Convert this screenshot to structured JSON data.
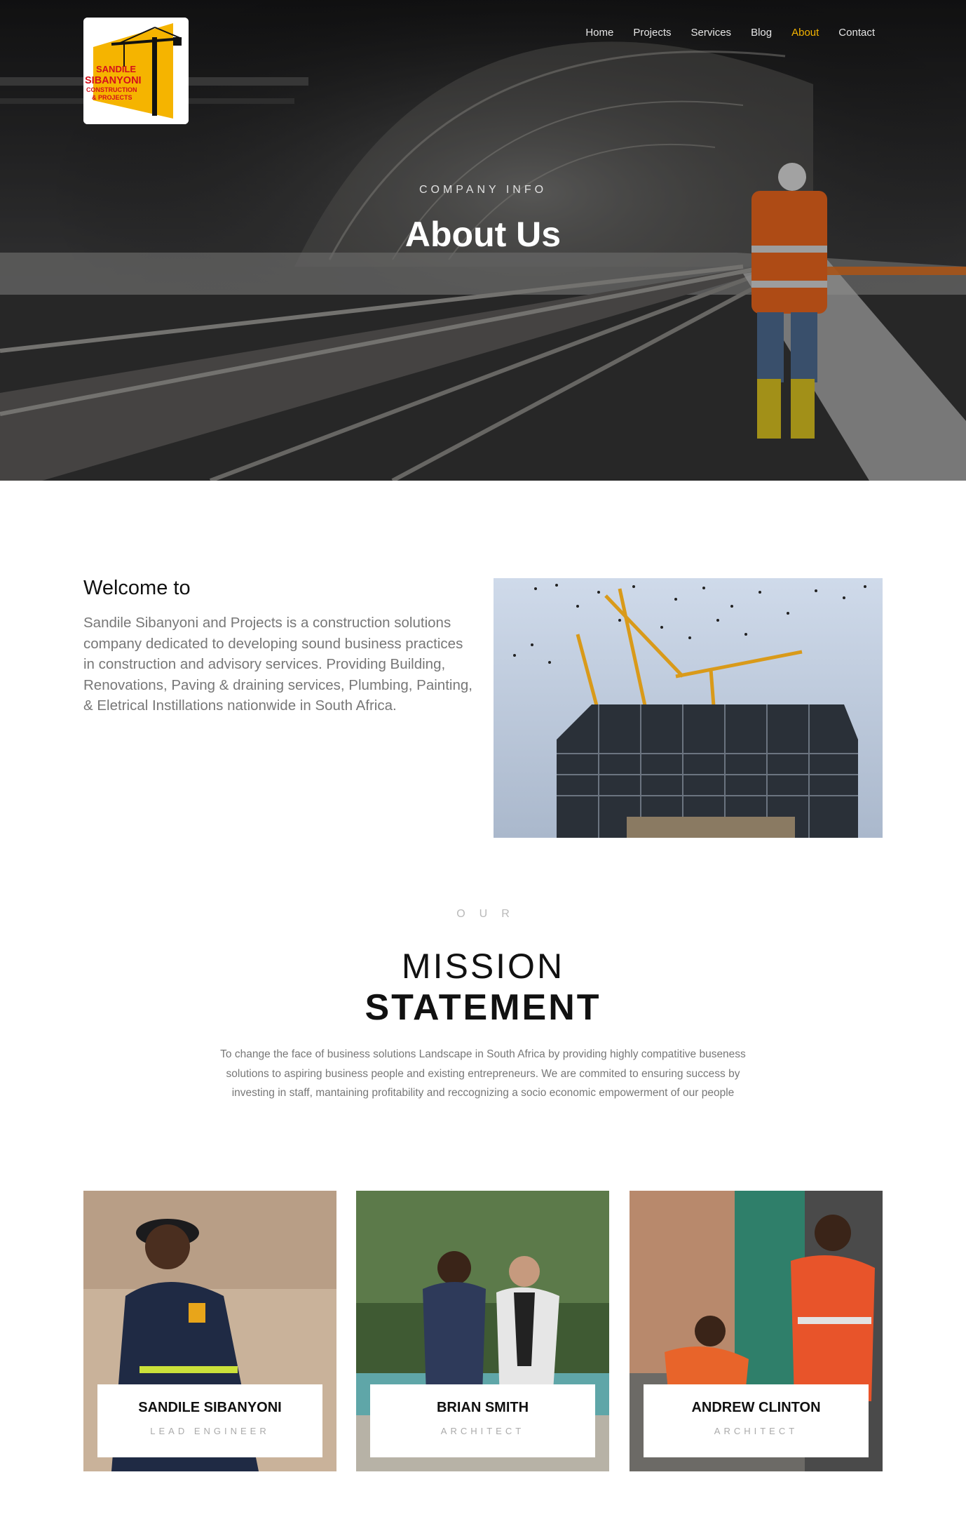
{
  "brand": {
    "logo_line1": "SANDILE",
    "logo_line2": "SIBANYONI",
    "logo_line3": "CONSTRUCTION",
    "logo_line4": "& PROJECTS",
    "accent_color": "#f5b400"
  },
  "nav": {
    "items": [
      {
        "label": "Home"
      },
      {
        "label": "Projects"
      },
      {
        "label": "Services"
      },
      {
        "label": "Blog"
      },
      {
        "label": "About",
        "active": true
      },
      {
        "label": "Contact"
      }
    ]
  },
  "hero": {
    "eyebrow": "COMPANY INFO",
    "title": "About Us"
  },
  "welcome": {
    "heading": "Welcome to",
    "body": "Sandile Sibanyoni and Projects is a construction solutions company dedicated to developing sound business practices in construction and advisory services. Providing Building, Renovations, Paving & draining services, Plumbing, Painting, & Eletrical Instillations nationwide in South Africa."
  },
  "mission": {
    "eyebrow": "OUR",
    "title_line1": "MISSION",
    "title_line2": "STATEMENT",
    "body": "To change the face of business solutions Landscape in South Africa by providing highly compatitive buseness solutions to aspiring business people and existing entrepreneurs. We are commited to ensuring success by investing in staff, mantaining profitability and reccognizing a socio economic empowerment of our people"
  },
  "team": [
    {
      "name": "SANDILE SIBANYONI",
      "role": "LEAD ENGINEER"
    },
    {
      "name": "BRIAN SMITH",
      "role": "ARCHITECT"
    },
    {
      "name": "ANDREW CLINTON",
      "role": "ARCHITECT"
    }
  ]
}
